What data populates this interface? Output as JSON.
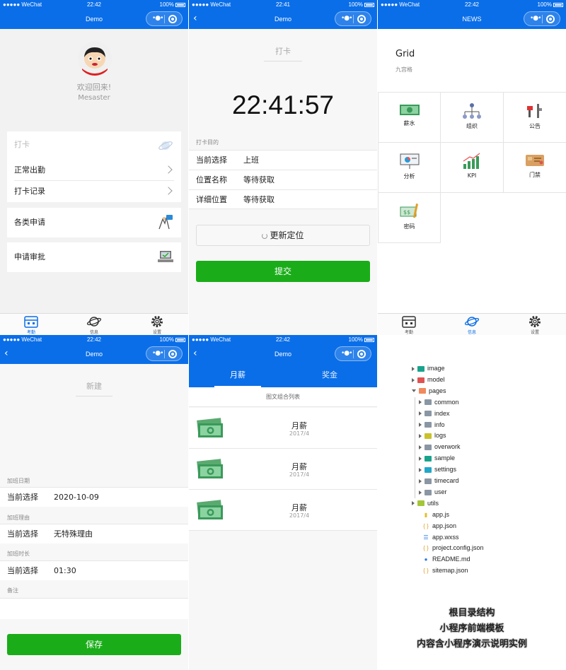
{
  "status": {
    "carrier": "●●●●● WeChat",
    "battery": "100%"
  },
  "panel1": {
    "time": "22:42",
    "title": "Demo",
    "welcome": "欢迎回来!",
    "username": "Mesaster",
    "checkin_header": "打卡",
    "items": [
      "正常出勤",
      "打卡记录"
    ],
    "apply": "各类申请",
    "approve": "申请审批"
  },
  "tabs": [
    {
      "label": "考勤"
    },
    {
      "label": "信息"
    },
    {
      "label": "设置"
    }
  ],
  "panel2": {
    "time": "22:41",
    "title": "Demo",
    "heading": "打卡",
    "clock": "22:41:57",
    "section": "打卡目的",
    "rows": [
      {
        "label": "当前选择",
        "value": "上班"
      },
      {
        "label": "位置名称",
        "value": "等待获取"
      },
      {
        "label": "详细位置",
        "value": "等待获取"
      }
    ],
    "refresh_button": "更新定位",
    "submit_button": "提交"
  },
  "panel3": {
    "time": "22:42",
    "title": "NEWS",
    "grid_title": "Grid",
    "grid_subtitle": "九宫格",
    "cells": [
      "薪水",
      "组织",
      "公告",
      "分析",
      "KPI",
      "门禁",
      "密码"
    ]
  },
  "panel4": {
    "time": "22:42",
    "title": "Demo",
    "heading": "新建",
    "sections": [
      {
        "label": "加班日期",
        "row_label": "当前选择",
        "row_value": "2020-10-09"
      },
      {
        "label": "加班理由",
        "row_label": "当前选择",
        "row_value": "无特殊理由"
      },
      {
        "label": "加班时长",
        "row_label": "当前选择",
        "row_value": "01:30"
      }
    ],
    "note_label": "备注",
    "save_button": "保存"
  },
  "panel5": {
    "time": "22:42",
    "title": "Demo",
    "tabs": [
      "月薪",
      "奖金"
    ],
    "list_title": "图文组合列表",
    "items": [
      {
        "title": "月薪",
        "date": "2017/4"
      },
      {
        "title": "月薪",
        "date": "2017/4"
      },
      {
        "title": "月薪",
        "date": "2017/4"
      }
    ]
  },
  "panel6": {
    "tree": [
      {
        "name": "image",
        "type": "folder",
        "color": "#1aa38c",
        "depth": 0,
        "open": false
      },
      {
        "name": "model",
        "type": "folder",
        "color": "#e05252",
        "depth": 0,
        "open": false
      },
      {
        "name": "pages",
        "type": "folder",
        "color": "#f08a5d",
        "depth": 0,
        "open": true
      },
      {
        "name": "common",
        "type": "folder",
        "color": "#8a96a3",
        "depth": 1,
        "open": false
      },
      {
        "name": "index",
        "type": "folder",
        "color": "#8a96a3",
        "depth": 1,
        "open": false
      },
      {
        "name": "info",
        "type": "folder",
        "color": "#8a96a3",
        "depth": 1,
        "open": false
      },
      {
        "name": "logs",
        "type": "folder",
        "color": "#c9c22a",
        "depth": 1,
        "open": false
      },
      {
        "name": "overwork",
        "type": "folder",
        "color": "#8a96a3",
        "depth": 1,
        "open": false
      },
      {
        "name": "sample",
        "type": "folder",
        "color": "#1aa38c",
        "depth": 1,
        "open": false
      },
      {
        "name": "settings",
        "type": "folder",
        "color": "#21a7c9",
        "depth": 1,
        "open": false
      },
      {
        "name": "timecard",
        "type": "folder",
        "color": "#8a96a3",
        "depth": 1,
        "open": false
      },
      {
        "name": "user",
        "type": "folder",
        "color": "#8a96a3",
        "depth": 1,
        "open": false
      },
      {
        "name": "utils",
        "type": "folder",
        "color": "#a4c639",
        "depth": 0,
        "open": false
      },
      {
        "name": "app.js",
        "type": "js",
        "color": "#e0c02a",
        "depth": 0
      },
      {
        "name": "app.json",
        "type": "json",
        "color": "#e0a02a",
        "depth": 0
      },
      {
        "name": "app.wxss",
        "type": "css",
        "color": "#2a7ae0",
        "depth": 0
      },
      {
        "name": "project.config.json",
        "type": "json",
        "color": "#e0a02a",
        "depth": 0
      },
      {
        "name": "README.md",
        "type": "info",
        "color": "#2a7ae0",
        "depth": 0
      },
      {
        "name": "sitemap.json",
        "type": "json",
        "color": "#e0a02a",
        "depth": 0
      }
    ],
    "caption": [
      "根目录结构",
      "小程序前端模板",
      "内容含小程序演示说明实例"
    ]
  },
  "colors": {
    "primary": "#0a6ee8",
    "success": "#1aad19"
  }
}
